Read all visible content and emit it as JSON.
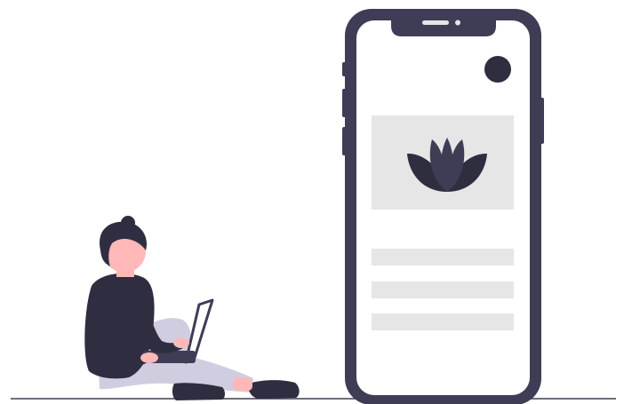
{
  "illustration": {
    "colors": {
      "background": "#ffffff",
      "phone_frame": "#3f3d56",
      "phone_screen": "#ffffff",
      "placeholder": "#e6e6e6",
      "lotus_light": "#3f3d56",
      "lotus_dark": "#2f2e41",
      "skin": "#ffb8b8",
      "hair": "#2f2e41",
      "sweater": "#2f2e41",
      "pants": "#d0cde1",
      "shoes": "#2f2e41",
      "laptop": "#3f3d56",
      "ground": "#3f3d56"
    },
    "icons": [
      "lotus-icon",
      "avatar-dot-icon",
      "phone-speaker-icon",
      "phone-camera-icon"
    ],
    "content_lines_count": 3
  }
}
